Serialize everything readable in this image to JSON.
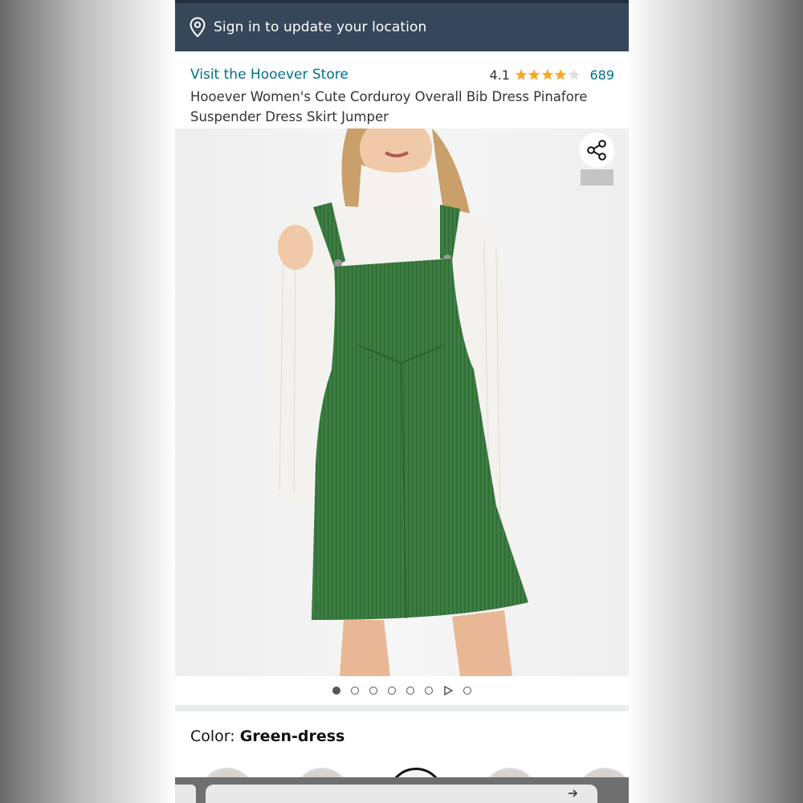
{
  "location_bar": {
    "text": "Sign in to update your location",
    "icon": "location-pin-icon"
  },
  "product": {
    "store_link": "Visit the Hooever Store",
    "rating": "4.1",
    "stars_filled": 4.1,
    "stars_total": 5,
    "review_count": "689",
    "title": "Hooever Women's Cute Corduroy Overall Bib Dress Pinafore Suspender Dress Skirt Jumper"
  },
  "gallery": {
    "image_description_name": "product-photo-green-corduroy-pinafore-dress",
    "active_index": 0,
    "dot_count_before_video": 6,
    "has_video": true,
    "dots_after_video": 1,
    "share_icon": "share-icon"
  },
  "color": {
    "label": "Color: ",
    "value": "Green-dress"
  },
  "colors": {
    "header_bg": "#37475a",
    "link": "#007185",
    "star": "#ffa41c",
    "dress_green": "#3a7a3e",
    "sweater": "#f4f2ef"
  }
}
